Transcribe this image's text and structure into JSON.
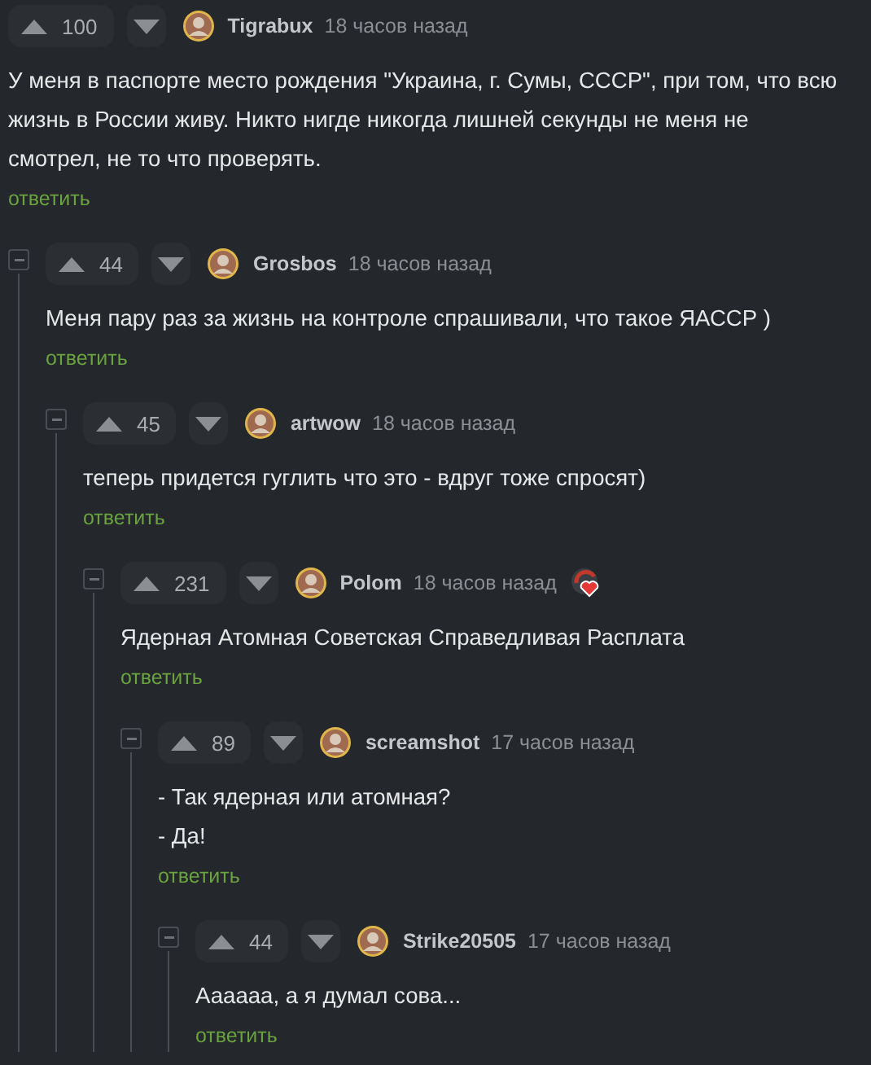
{
  "comments": [
    {
      "rating": "100",
      "author": "Tigrabux",
      "time": "18 часов назад",
      "award": false,
      "paragraphs": [
        "У меня в паспорте место рождения \"Украина, г. Сумы, СССР\", при том, что всю жизнь в России живу. Никто нигде никогда лишней секунды не меня не смотрел, не то что проверять."
      ],
      "reply": "ответить",
      "children": [
        {
          "rating": "44",
          "author": "Grosbos",
          "time": "18 часов назад",
          "award": false,
          "paragraphs": [
            "Меня пару раз за жизнь на контроле спрашивали, что такое ЯАССР )"
          ],
          "reply": "ответить",
          "children": [
            {
              "rating": "45",
              "author": "artwow",
              "time": "18 часов назад",
              "award": false,
              "paragraphs": [
                "теперь придется гуглить что это - вдруг тоже спросят)"
              ],
              "reply": "ответить",
              "children": [
                {
                  "rating": "231",
                  "author": "Polom",
                  "time": "18 часов назад",
                  "award": true,
                  "paragraphs": [
                    "Ядерная Атомная Советская Справедливая Расплата"
                  ],
                  "reply": "ответить",
                  "children": [
                    {
                      "rating": "89",
                      "author": "screamshot",
                      "time": "17 часов назад",
                      "award": false,
                      "paragraphs": [
                        "- Так ядерная или атомная?",
                        "- Да!"
                      ],
                      "reply": "ответить",
                      "children": [
                        {
                          "rating": "44",
                          "author": "Strike20505",
                          "time": "17 часов назад",
                          "award": false,
                          "paragraphs": [
                            "Аааааа, а я думал сова..."
                          ],
                          "reply": "ответить"
                        }
                      ]
                    }
                  ]
                }
              ]
            }
          ]
        }
      ]
    }
  ]
}
